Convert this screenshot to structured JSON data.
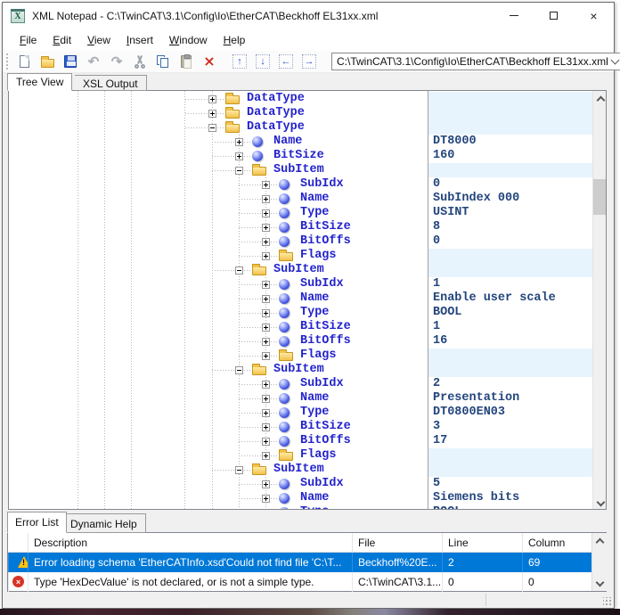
{
  "window": {
    "title": "XML Notepad - C:\\TwinCAT\\3.1\\Config\\Io\\EtherCAT\\Beckhoff EL31xx.xml",
    "controls": {
      "minimize": "minimize",
      "maximize": "maximize",
      "close": "close"
    }
  },
  "menu": {
    "items": [
      "File",
      "Edit",
      "View",
      "Insert",
      "Window",
      "Help"
    ]
  },
  "toolbar": {
    "icons": [
      "new-file",
      "open-file",
      "save-file",
      "undo",
      "redo",
      "cut",
      "copy",
      "paste",
      "delete",
      "nudge-up",
      "nudge-down",
      "nudge-left",
      "nudge-right"
    ],
    "path_value": "C:\\TwinCAT\\3.1\\Config\\Io\\EtherCAT\\Beckhoff EL31xx.xml"
  },
  "tabs": {
    "tree_view": "Tree View",
    "xsl_output": "XSL Output"
  },
  "tree": {
    "rows": [
      {
        "level": 0,
        "expander": "+",
        "icon": "folder",
        "label": "DataType",
        "value": "",
        "container": true
      },
      {
        "level": 0,
        "expander": "+",
        "icon": "folder",
        "label": "DataType",
        "value": "",
        "container": true
      },
      {
        "level": 0,
        "expander": "-",
        "icon": "folder",
        "label": "DataType",
        "value": "",
        "container": true
      },
      {
        "level": 1,
        "expander": "+",
        "icon": "element",
        "label": "Name",
        "value": "DT8000",
        "container": false
      },
      {
        "level": 1,
        "expander": "+",
        "icon": "element",
        "label": "BitSize",
        "value": "160",
        "container": false
      },
      {
        "level": 1,
        "expander": "-",
        "icon": "folder",
        "label": "SubItem",
        "value": "",
        "container": true
      },
      {
        "level": 2,
        "expander": "+",
        "icon": "element",
        "label": "SubIdx",
        "value": "0",
        "container": false
      },
      {
        "level": 2,
        "expander": "+",
        "icon": "element",
        "label": "Name",
        "value": "SubIndex 000",
        "container": false
      },
      {
        "level": 2,
        "expander": "+",
        "icon": "element",
        "label": "Type",
        "value": "USINT",
        "container": false
      },
      {
        "level": 2,
        "expander": "+",
        "icon": "element",
        "label": "BitSize",
        "value": "8",
        "container": false
      },
      {
        "level": 2,
        "expander": "+",
        "icon": "element",
        "label": "BitOffs",
        "value": "0",
        "container": false
      },
      {
        "level": 2,
        "expander": "+",
        "icon": "folder",
        "label": "Flags",
        "value": "",
        "container": true
      },
      {
        "level": 1,
        "expander": "-",
        "icon": "folder",
        "label": "SubItem",
        "value": "",
        "container": true
      },
      {
        "level": 2,
        "expander": "+",
        "icon": "element",
        "label": "SubIdx",
        "value": "1",
        "container": false
      },
      {
        "level": 2,
        "expander": "+",
        "icon": "element",
        "label": "Name",
        "value": "Enable user scale",
        "container": false
      },
      {
        "level": 2,
        "expander": "+",
        "icon": "element",
        "label": "Type",
        "value": "BOOL",
        "container": false
      },
      {
        "level": 2,
        "expander": "+",
        "icon": "element",
        "label": "BitSize",
        "value": "1",
        "container": false
      },
      {
        "level": 2,
        "expander": "+",
        "icon": "element",
        "label": "BitOffs",
        "value": "16",
        "container": false
      },
      {
        "level": 2,
        "expander": "+",
        "icon": "folder",
        "label": "Flags",
        "value": "",
        "container": true
      },
      {
        "level": 1,
        "expander": "-",
        "icon": "folder",
        "label": "SubItem",
        "value": "",
        "container": true
      },
      {
        "level": 2,
        "expander": "+",
        "icon": "element",
        "label": "SubIdx",
        "value": "2",
        "container": false
      },
      {
        "level": 2,
        "expander": "+",
        "icon": "element",
        "label": "Name",
        "value": "Presentation",
        "container": false
      },
      {
        "level": 2,
        "expander": "+",
        "icon": "element",
        "label": "Type",
        "value": "DT0800EN03",
        "container": false
      },
      {
        "level": 2,
        "expander": "+",
        "icon": "element",
        "label": "BitSize",
        "value": "3",
        "container": false
      },
      {
        "level": 2,
        "expander": "+",
        "icon": "element",
        "label": "BitOffs",
        "value": "17",
        "container": false
      },
      {
        "level": 2,
        "expander": "+",
        "icon": "folder",
        "label": "Flags",
        "value": "",
        "container": true
      },
      {
        "level": 1,
        "expander": "-",
        "icon": "folder",
        "label": "SubItem",
        "value": "",
        "container": true
      },
      {
        "level": 2,
        "expander": "+",
        "icon": "element",
        "label": "SubIdx",
        "value": "5",
        "container": false
      },
      {
        "level": 2,
        "expander": "+",
        "icon": "element",
        "label": "Name",
        "value": "Siemens bits",
        "container": false
      },
      {
        "level": 2,
        "expander": "+",
        "icon": "element",
        "label": "Type",
        "value": "BOOL",
        "container": false
      }
    ]
  },
  "error_panel": {
    "tabs": [
      "Error List",
      "Dynamic Help"
    ],
    "columns": [
      "Description",
      "File",
      "Line",
      "Column"
    ],
    "rows": [
      {
        "severity": "warning",
        "selected": true,
        "description": "Error loading schema 'EtherCATInfo.xsd'Could not find file 'C:\\T...",
        "file": "Beckhoff%20E...",
        "line": "2",
        "column": "69"
      },
      {
        "severity": "error",
        "selected": false,
        "description": "Type 'HexDecValue' is not declared, or is not a simple type.",
        "file": "C:\\TwinCAT\\3.1...",
        "line": "0",
        "column": "0"
      }
    ]
  },
  "colors": {
    "selection": "#0078d7",
    "container_row_bg": "#e8f4fd",
    "tree_text": "#2323cc",
    "value_text": "#23457c",
    "warning": "#ffc20e",
    "error": "#d63426"
  }
}
